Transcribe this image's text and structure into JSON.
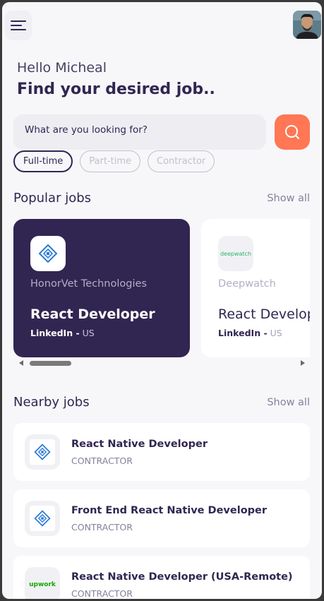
{
  "greeting": "Hello Micheal",
  "headline": "Find your desired job..",
  "search": {
    "placeholder": "What are you looking for?"
  },
  "tabs": [
    {
      "label": "Full-time",
      "active": true
    },
    {
      "label": "Part-time",
      "active": false
    },
    {
      "label": "Contractor",
      "active": false
    }
  ],
  "popular": {
    "title": "Popular jobs",
    "show_all": "Show all",
    "cards": [
      {
        "company": "HonorVet Technologies",
        "role": "React Developer",
        "publisher": "LinkedIn -",
        "location": "US",
        "logo_icon": "honorvet-logo-icon"
      },
      {
        "company": "Deepwatch",
        "role": "React Developer",
        "publisher": "LinkedIn -",
        "location": "US",
        "logo_icon": "deepwatch-logo-icon",
        "logo_text": "deepwatch"
      }
    ]
  },
  "nearby": {
    "title": "Nearby jobs",
    "show_all": "Show all",
    "items": [
      {
        "title": "React Native Developer",
        "type": "CONTRACTOR",
        "logo_icon": "honorvet-logo-icon"
      },
      {
        "title": "Front End React Native Developer",
        "type": "CONTRACTOR",
        "logo_icon": "honorvet-logo-icon"
      },
      {
        "title": "React Native Developer (USA-Remote)",
        "type": "CONTRACTOR",
        "logo_icon": "upwork-logo-icon",
        "logo_text": "upwork"
      }
    ]
  },
  "colors": {
    "primary": "#312651",
    "accent": "#ff7754",
    "background": "#f7f7fa",
    "muted": "#83829a"
  }
}
